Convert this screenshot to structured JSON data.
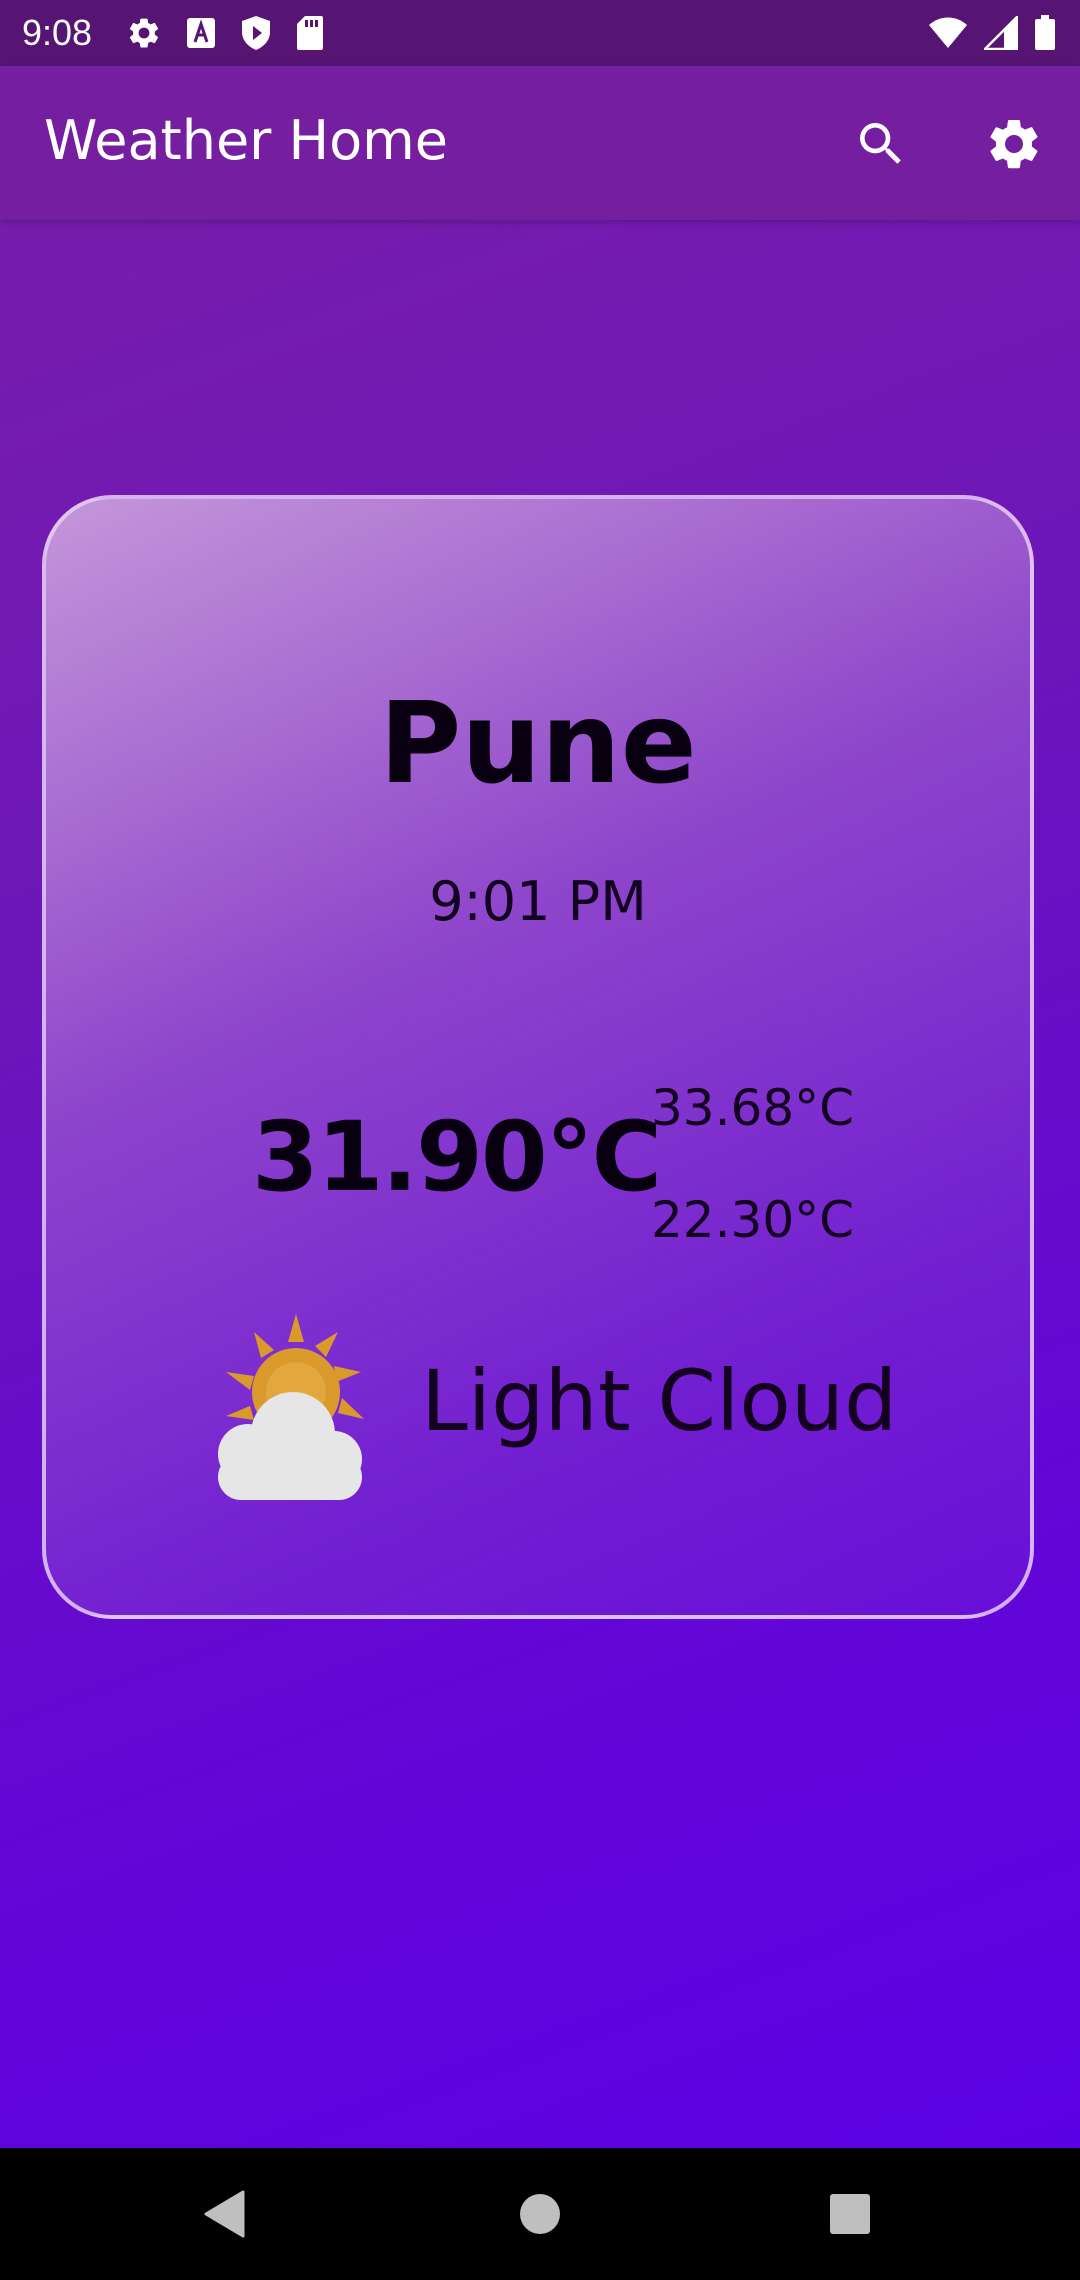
{
  "status_bar": {
    "time": "9:08",
    "left_icons": [
      "settings-gear-icon",
      "font-a-icon",
      "shield-play-icon",
      "sd-card-icon"
    ],
    "right_icons": [
      "wifi-icon",
      "cell-signal-icon",
      "battery-icon"
    ]
  },
  "app_bar": {
    "title": "Weather Home",
    "actions": [
      "search-icon",
      "settings-icon"
    ]
  },
  "weather": {
    "city": "Pune",
    "time": "9:01 PM",
    "current_temp": "31.90°C",
    "temp_max": "33.68°C",
    "temp_min": "22.30°C",
    "condition": "Light Cloud",
    "condition_icon": "partly-cloudy-icon"
  },
  "navigation": {
    "buttons": [
      "back-icon",
      "home-icon",
      "recents-icon"
    ]
  },
  "colors": {
    "status_bar": "#561473",
    "app_bar": "#761ea0",
    "background_top": "#7a1ea8",
    "background_bottom": "#5b00e8",
    "sun": "#d99a2b",
    "cloud": "#e6e6e6"
  }
}
